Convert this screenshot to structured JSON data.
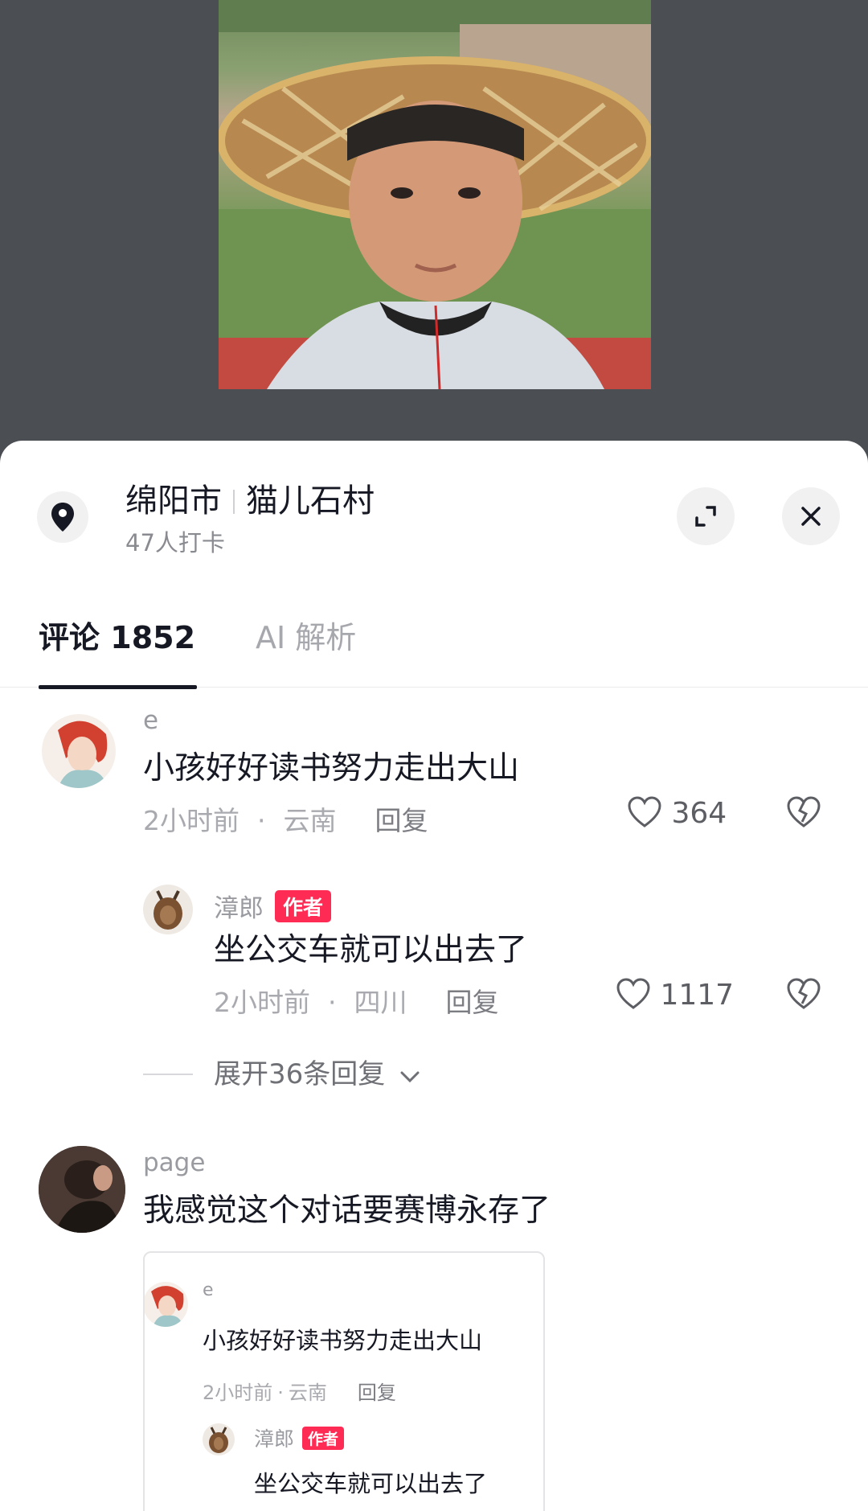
{
  "location": {
    "city": "绵阳市",
    "village": "猫儿石村",
    "checkins": "47人打卡"
  },
  "tabs": {
    "comments_label": "评论",
    "comments_count": "1852",
    "ai_label": "AI 解析"
  },
  "comments": [
    {
      "username": "e",
      "text": "小孩好好读书努力走出大山",
      "time": "2小时前",
      "region": "云南",
      "reply_label": "回复",
      "likes": "364",
      "replies": [
        {
          "username": "漳郎",
          "badge": "作者",
          "text": "坐公交车就可以出去了",
          "time": "2小时前",
          "region": "四川",
          "reply_label": "回复",
          "likes": "1117"
        }
      ],
      "expand_label": "展开36条回复"
    },
    {
      "username": "page",
      "text": "我感觉这个对话要赛博永存了",
      "quote": {
        "username": "e",
        "text": "小孩好好读书努力走出大山",
        "time": "2小时前",
        "region": "云南",
        "reply_label": "回复",
        "reply_username": "漳郎",
        "reply_badge": "作者",
        "reply_text": "坐公交车就可以出去了"
      }
    }
  ],
  "colors": {
    "accent": "#fe2c55",
    "text_primary": "#161823",
    "text_secondary": "#a9aaaf",
    "backdrop": "#4b4e53"
  },
  "icons": [
    "location-pin-icon",
    "expand-icon",
    "close-icon",
    "heart-icon",
    "broken-heart-icon",
    "chevron-down-icon"
  ]
}
